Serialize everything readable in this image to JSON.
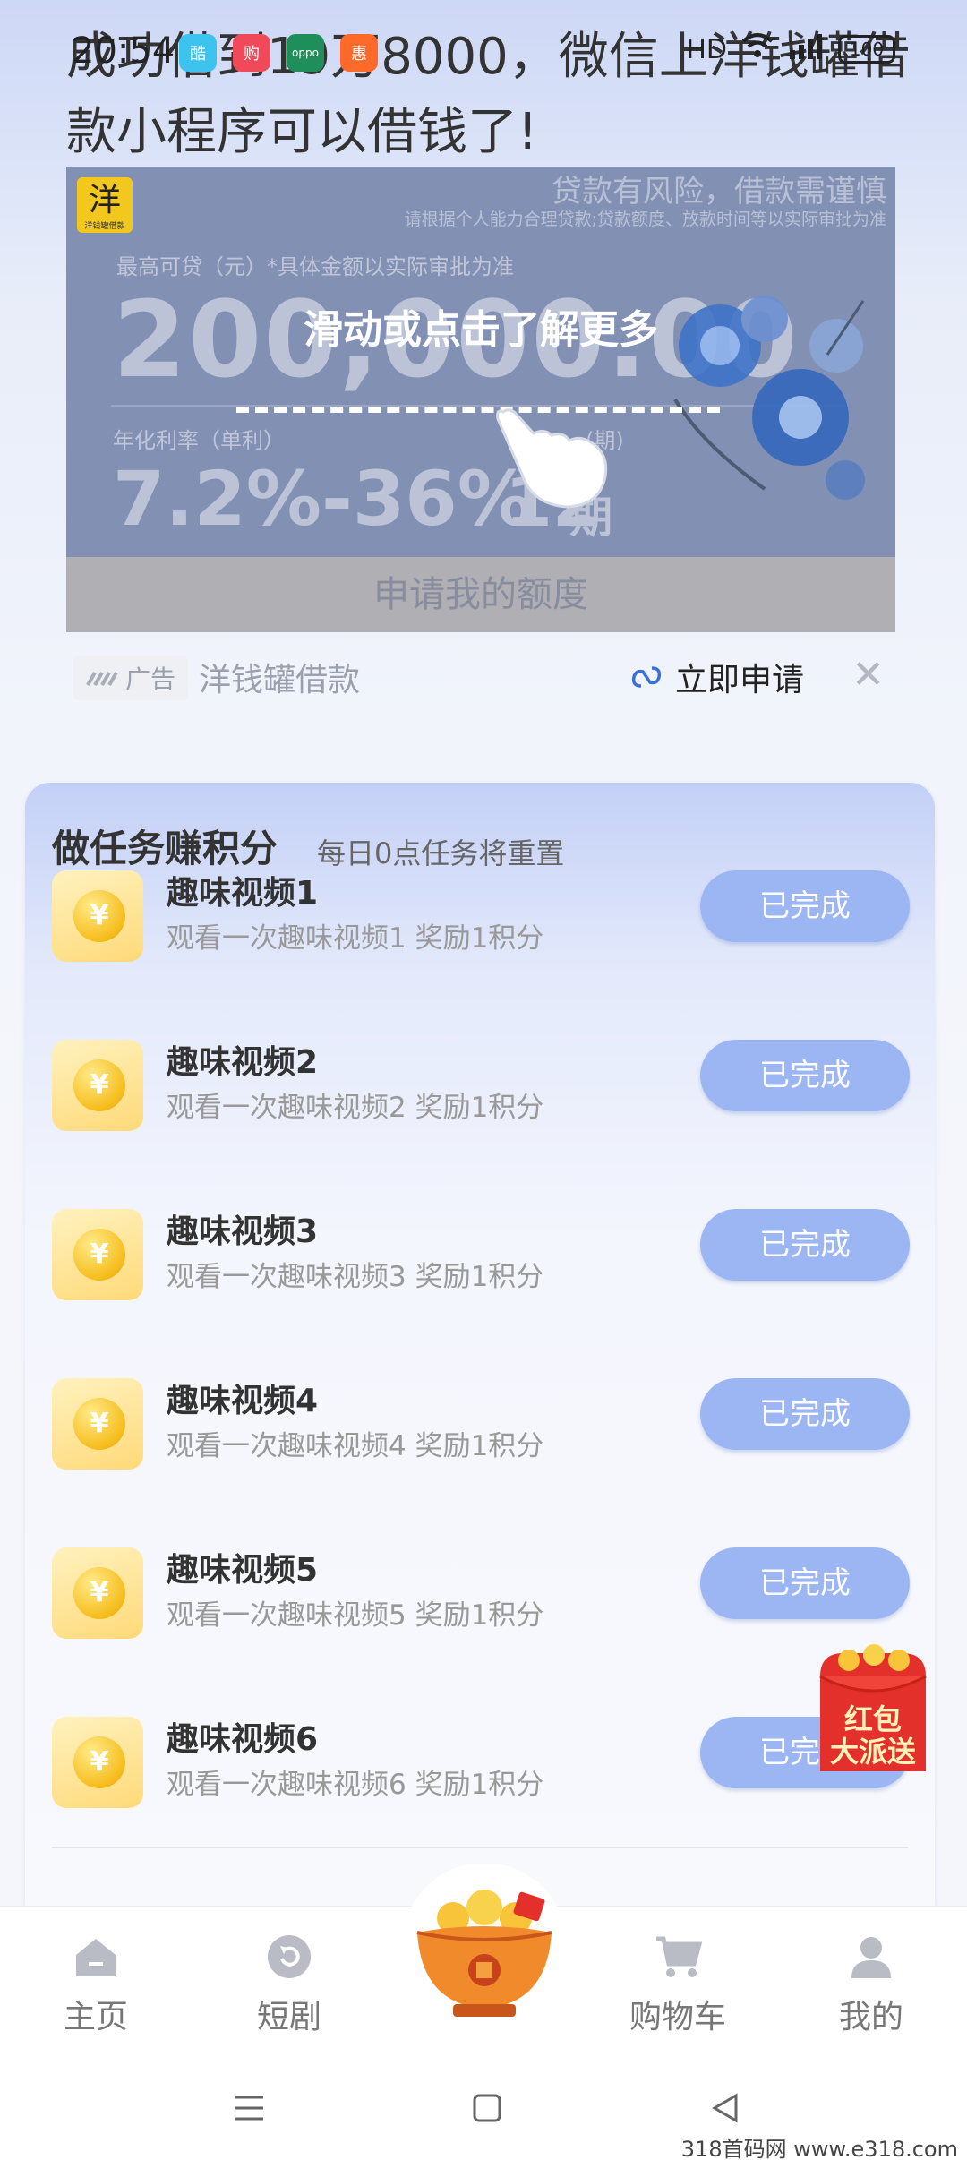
{
  "status_bar": {
    "time": "20:54",
    "apps": [
      "酷",
      "购",
      "oppo",
      "惠"
    ],
    "network": "HD",
    "battery": "100"
  },
  "headline": "成功借到19万8000，微信上洋钱罐借款小程序可以借钱了!",
  "ad": {
    "logo": "洋",
    "logo_sub": "洋钱罐借款",
    "risk": "贷款有风险，借款需谨慎",
    "risk_sub": "请根据个人能力合理贷款;贷款额度、放款时间等以实际审批为准",
    "limit_label": "最高可贷（元）*具体金额以实际审批为准",
    "amount": "200,000.00",
    "rate_label": "年化利率（单利）",
    "period_label": "(期)",
    "rate": "7.2%-36%",
    "period": "12",
    "period_unit": "期",
    "apply_bar": "申请我的额度",
    "swipe_hint": "滑动或点击了解更多",
    "tag": "广告",
    "source": "洋钱罐借款",
    "apply_link": "立即申请",
    "colors": {
      "banner_bg": "#8290b4",
      "apply_bar_bg": "#b0b0b4"
    }
  },
  "tasks": {
    "title": "做任务赚积分",
    "subtitle": "每日0点任务将重置",
    "items": [
      {
        "name": "趣味视频1",
        "desc": "观看一次趣味视频1 奖励1积分",
        "button": "已完成"
      },
      {
        "name": "趣味视频2",
        "desc": "观看一次趣味视频2 奖励1积分",
        "button": "已完成"
      },
      {
        "name": "趣味视频3",
        "desc": "观看一次趣味视频3 奖励1积分",
        "button": "已完成"
      },
      {
        "name": "趣味视频4",
        "desc": "观看一次趣味视频4 奖励1积分",
        "button": "已完成"
      },
      {
        "name": "趣味视频5",
        "desc": "观看一次趣味视频5 奖励1积分",
        "button": "已完成"
      },
      {
        "name": "趣味视频6",
        "desc": "观看一次趣味视频6 奖励1积分",
        "button": "已完成"
      }
    ],
    "colors": {
      "button": "#9cb6f4"
    }
  },
  "red_packet": {
    "line1": "红包",
    "line2": "大派送"
  },
  "bottom_nav": {
    "items": [
      {
        "label": "主页",
        "icon": "home-icon"
      },
      {
        "label": "短剧",
        "icon": "refresh-icon"
      },
      {
        "label": "购物车",
        "icon": "cart-icon"
      },
      {
        "label": "我的",
        "icon": "user-icon"
      }
    ],
    "center_icon": "treasure-bowl-icon"
  },
  "watermark": "318首码网 www.e318.com"
}
